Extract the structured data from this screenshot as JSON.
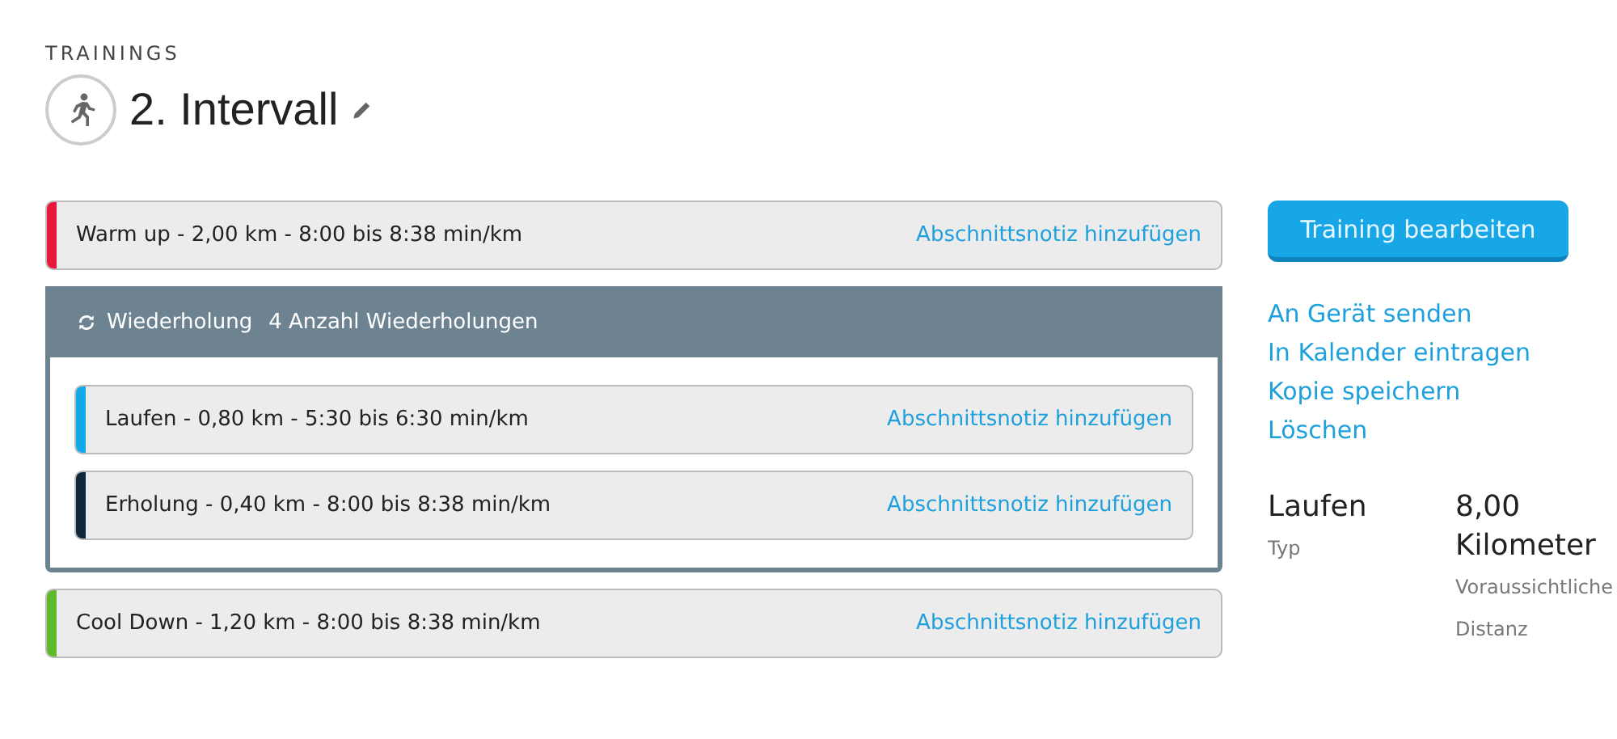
{
  "header": {
    "section": "TRAININGS",
    "title": "2. Intervall"
  },
  "steps": [
    {
      "kind": "step",
      "text": "Warm up - 2,00 km - 8:00 bis 8:38 min/km",
      "link": "Abschnittsnotiz hinzufügen",
      "color": "#e8173c"
    },
    {
      "kind": "repeat",
      "label": "Wiederholung",
      "count": "4 Anzahl Wiederholungen",
      "children": [
        {
          "kind": "step",
          "text": "Laufen - 0,80 km - 5:30 bis 6:30 min/km",
          "link": "Abschnittsnotiz hinzufügen",
          "color": "#11a9e6"
        },
        {
          "kind": "step",
          "text": "Erholung - 0,40 km - 8:00 bis 8:38 min/km",
          "link": "Abschnittsnotiz hinzufügen",
          "color": "#10283b"
        }
      ]
    },
    {
      "kind": "step",
      "text": "Cool Down - 1,20 km - 8:00 bis 8:38 min/km",
      "link": "Abschnittsnotiz hinzufügen",
      "color": "#5fb92a"
    }
  ],
  "sidebar": {
    "button": "Training bearbeiten",
    "links": [
      "An Gerät senden",
      "In Kalender eintragen",
      "Kopie speichern",
      "Löschen"
    ],
    "stats": [
      {
        "value": "Laufen",
        "label": "Typ"
      },
      {
        "value": "8,00 Kilometer",
        "label": "Voraussichtliche Distanz"
      }
    ]
  }
}
